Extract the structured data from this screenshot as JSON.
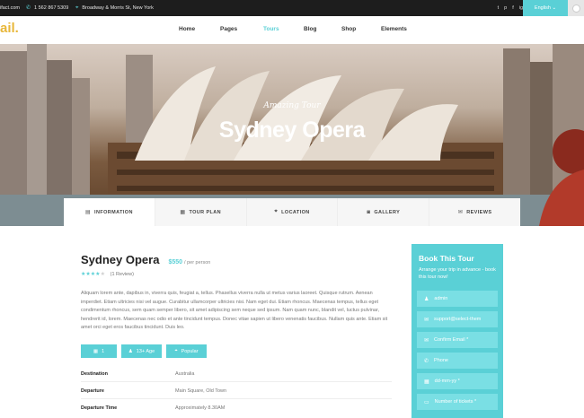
{
  "topbar": {
    "email": "ifact.com",
    "phone": "1 562 867 5309",
    "address": "Broadway & Morris St, New York",
    "social": [
      "t",
      "p",
      "f",
      "ig"
    ],
    "language": "English"
  },
  "nav": {
    "logo": "ail.",
    "items": [
      {
        "label": "Home",
        "active": false
      },
      {
        "label": "Pages",
        "active": false
      },
      {
        "label": "Tours",
        "active": true
      },
      {
        "label": "Blog",
        "active": false
      },
      {
        "label": "Shop",
        "active": false
      },
      {
        "label": "Elements",
        "active": false
      }
    ]
  },
  "hero": {
    "subtitle": "Amazing Tour",
    "title": "Sydney Opera"
  },
  "tabs": [
    {
      "label": "INFORMATION",
      "icon": "document-icon",
      "active": true
    },
    {
      "label": "TOUR PLAN",
      "icon": "calendar-icon",
      "active": false
    },
    {
      "label": "LOCATION",
      "icon": "map-pin-icon",
      "active": false
    },
    {
      "label": "GALLERY",
      "icon": "camera-icon",
      "active": false
    },
    {
      "label": "REVIEWS",
      "icon": "chat-icon",
      "active": false
    }
  ],
  "tour": {
    "title": "Sydney Opera",
    "price": "$550",
    "per": "/ per person",
    "rating": 4,
    "review_count": "(1 Review)",
    "description": "Aliquam lorem ante, dapibus in, viverra quis, feugiat a, tellus. Phasellus viverra nulla ut metus varius laoreet. Quisque rutrum. Aenean imperdiet. Etiam ultricies nisi vel augue. Curabitur ullamcorper ultricies nisi. Nam eget dui. Etiam rhoncus. Maecenas tempus, tellus eget condimentum rhoncus, sem quam semper libero, sit amet adipiscing sem neque sed ipsum. Nam quam nunc, blandit vel, luctus pulvinar, hendrerit id, lorem. Maecenas nec odio et ante tincidunt tempus. Donec vitae sapien ut libero venenatis faucibus. Nullam quis ante. Etiam sit amet orci eget eros faucibus tincidunt. Duis leo.",
    "pills": [
      {
        "label": "1",
        "icon": "calendar-icon"
      },
      {
        "label": "13+ Age",
        "icon": "user-icon"
      },
      {
        "label": "Popular",
        "icon": "map-pin-icon"
      }
    ],
    "details": [
      {
        "key": "Destination",
        "value": "Australia"
      },
      {
        "key": "Departure",
        "value": "Main Square, Old Town"
      },
      {
        "key": "Departure Time",
        "value": "Approximately 8.30AM"
      }
    ]
  },
  "booking": {
    "title": "Book This Tour",
    "subtitle": "Arrange your trip in advance - book this tour now!",
    "fields": [
      {
        "placeholder": "admin",
        "icon": "user-icon"
      },
      {
        "placeholder": "support@select-them",
        "icon": "email-icon"
      },
      {
        "placeholder": "Confirm Email *",
        "icon": "email-icon"
      },
      {
        "placeholder": "Phone",
        "icon": "phone-icon"
      },
      {
        "placeholder": "dd-mm-yy *",
        "icon": "calendar-icon"
      },
      {
        "placeholder": "Number of tickets *",
        "icon": "ticket-icon"
      }
    ]
  }
}
